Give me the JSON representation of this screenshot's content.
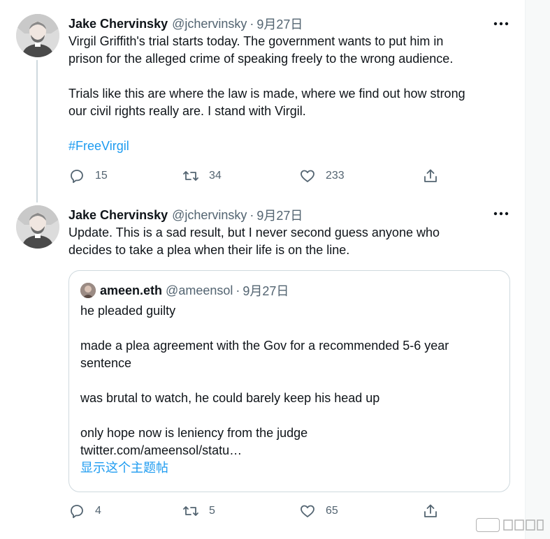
{
  "tweets": [
    {
      "author": {
        "name": "Jake Chervinsky",
        "handle": "@jchervinsky",
        "separator": "·",
        "date": "9月27日"
      },
      "paragraphs": [
        "Virgil Griffith's trial starts today. The government wants to put him in\nprison for the alleged crime of speaking freely to the wrong audience.",
        "Trials like this are where the law is made, where we find out how strong\nour civil rights really are. I stand with Virgil."
      ],
      "hashtag": "#FreeVirgil",
      "stats": {
        "replies": "15",
        "retweets": "34",
        "likes": "233"
      }
    },
    {
      "author": {
        "name": "Jake Chervinsky",
        "handle": "@jchervinsky",
        "separator": "·",
        "date": "9月27日"
      },
      "paragraphs": [
        "Update. This is a sad result, but I never second guess anyone who\ndecides to take a plea when their life is on the line."
      ],
      "quote": {
        "name": "ameen.eth",
        "handle": "@ameensol",
        "separator": "·",
        "date": "9月27日",
        "paragraphs": [
          "he pleaded guilty",
          "made a plea agreement with the Gov for a recommended 5-6 year\nsentence",
          "was brutal to watch, he could barely keep his head up",
          "only hope now is leniency from the judge\ntwitter.com/ameensol/statu…"
        ],
        "show_thread": "显示这个主题帖"
      },
      "stats": {
        "replies": "4",
        "retweets": "5",
        "likes": "65"
      }
    }
  ],
  "icons": {
    "more": "more-icon",
    "reply": "reply-icon",
    "retweet": "retweet-icon",
    "like": "like-icon",
    "share": "share-icon"
  },
  "colors": {
    "link": "#1d9bf0",
    "secondary_text": "#536471",
    "primary_text": "#0f1419",
    "border": "#cfd9de"
  }
}
